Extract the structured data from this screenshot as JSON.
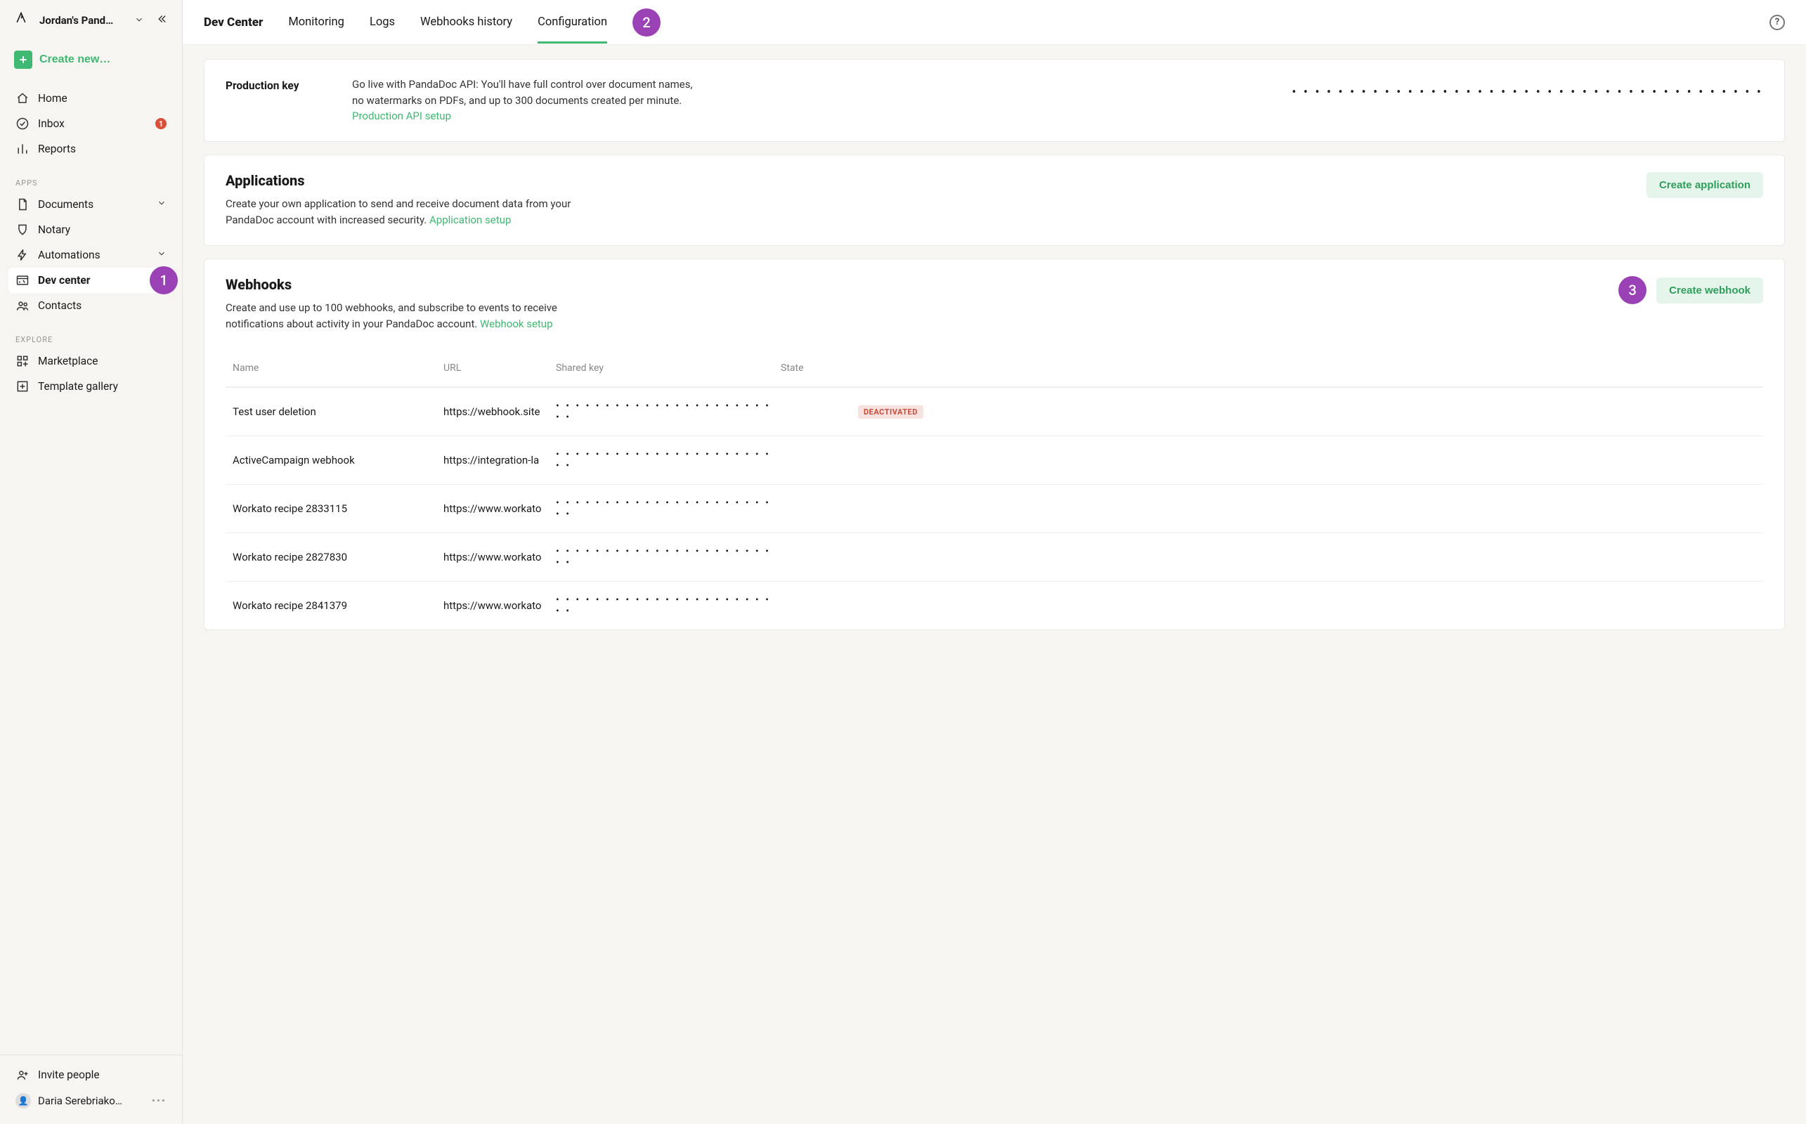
{
  "workspace_name": "Jordan's Pand…",
  "create_label": "Create new…",
  "nav_primary": [
    {
      "id": "home",
      "label": "Home",
      "badge": null
    },
    {
      "id": "inbox",
      "label": "Inbox",
      "badge": "1"
    },
    {
      "id": "reports",
      "label": "Reports",
      "badge": null
    }
  ],
  "section_apps_label": "APPS",
  "nav_apps": [
    {
      "id": "documents",
      "label": "Documents",
      "expandable": true
    },
    {
      "id": "notary",
      "label": "Notary",
      "expandable": false
    },
    {
      "id": "automations",
      "label": "Automations",
      "expandable": true
    },
    {
      "id": "dev-center",
      "label": "Dev center",
      "expandable": false,
      "active": true
    },
    {
      "id": "contacts",
      "label": "Contacts",
      "expandable": false
    }
  ],
  "section_explore_label": "EXPLORE",
  "nav_explore": [
    {
      "id": "marketplace",
      "label": "Marketplace"
    },
    {
      "id": "template-gallery",
      "label": "Template gallery"
    }
  ],
  "invite_label": "Invite people",
  "user_name": "Daria Serebriako…",
  "topbar": {
    "title": "Dev Center",
    "tabs": [
      {
        "id": "monitoring",
        "label": "Monitoring"
      },
      {
        "id": "logs",
        "label": "Logs"
      },
      {
        "id": "webhooks-history",
        "label": "Webhooks history"
      },
      {
        "id": "configuration",
        "label": "Configuration",
        "active": true
      }
    ]
  },
  "annotations": {
    "a1": "1",
    "a2": "2",
    "a3": "3"
  },
  "production_key": {
    "label": "Production key",
    "desc_before": "Go live with PandaDoc API: You'll have full control over document names, no watermarks on PDFs, and up to 300 documents created per minute. ",
    "link": "Production API setup",
    "masked": "• • • • • • • • • • • • • • • • • • • • • • • • • • • • • • • • • • • • • • • • •"
  },
  "applications": {
    "heading": "Applications",
    "desc_before": "Create your own application to send and receive document data from your PandaDoc account with increased security. ",
    "link": "Application setup",
    "button": "Create application"
  },
  "webhooks": {
    "heading": "Webhooks",
    "desc_before": "Create and use up to 100 webhooks, and subscribe to events to receive notifications about activity in your PandaDoc account. ",
    "link": "Webhook setup",
    "button": "Create webhook",
    "columns": {
      "name": "Name",
      "url": "URL",
      "shared": "Shared key",
      "state": "State"
    },
    "rows": [
      {
        "name": "Test user deletion",
        "url": "https://webhook.site",
        "shared": "• • • • • • • • • • • • • • • • • • • • • • • •",
        "active": false,
        "status": "DEACTIVATED"
      },
      {
        "name": "ActiveCampaign webhook",
        "url": "https://integration-la",
        "shared": "• • • • • • • • • • • • • • • • • • • • • • • •",
        "active": true,
        "status": ""
      },
      {
        "name": "Workato recipe 2833115",
        "url": "https://www.workato",
        "shared": "• • • • • • • • • • • • • • • • • • • • • • • •",
        "active": true,
        "status": ""
      },
      {
        "name": "Workato recipe 2827830",
        "url": "https://www.workato",
        "shared": "• • • • • • • • • • • • • • • • • • • • • • • •",
        "active": true,
        "status": ""
      },
      {
        "name": "Workato recipe 2841379",
        "url": "https://www.workato",
        "shared": "• • • • • • • • • • • • • • • • • • • • • • • •",
        "active": true,
        "status": ""
      }
    ]
  }
}
